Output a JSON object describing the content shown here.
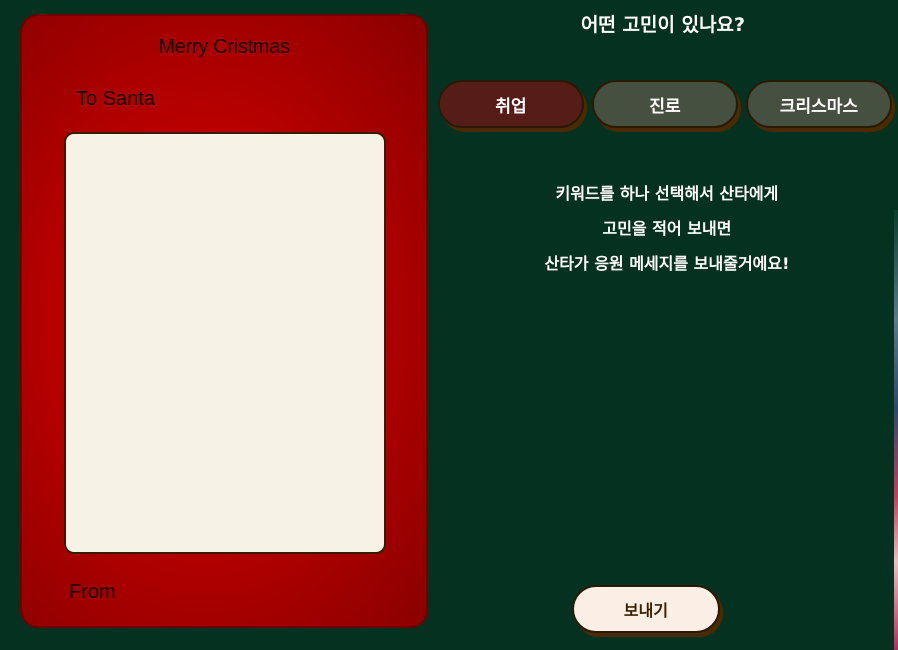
{
  "letter_card": {
    "title": "Merry Cristmas",
    "to_label": "To Santa",
    "from_label": "From",
    "textarea_value": ""
  },
  "question": "어떤 고민이 있나요?",
  "keywords": [
    {
      "label": "취업",
      "selected": true
    },
    {
      "label": "진로",
      "selected": false
    },
    {
      "label": "크리스마스",
      "selected": false
    }
  ],
  "instructions": [
    "키워드를 하나 선택해서 산타에게",
    "고민을 적어 보내면",
    "산타가 응원 메세지를 보내줄거에요!"
  ],
  "send_button": "보내기",
  "colors": {
    "background": "#053220",
    "card_red": "#c00000",
    "selected_keyword": "#561d18",
    "keyword": "#465040",
    "send_button": "#fbeee4"
  }
}
